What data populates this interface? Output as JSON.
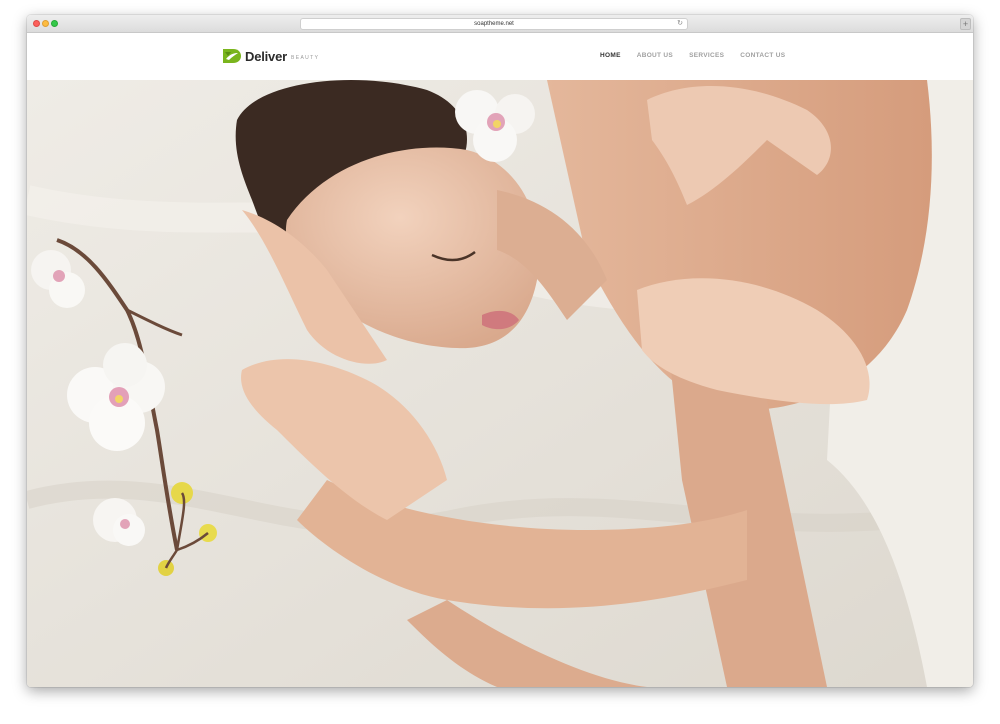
{
  "browser": {
    "url": "soaptheme.net"
  },
  "brand": {
    "name": "Deliver",
    "tagline": "BEAUTY",
    "accent_color": "#7ab51d"
  },
  "nav": {
    "items": [
      {
        "label": "HOME",
        "active": true
      },
      {
        "label": "ABOUT US",
        "active": false
      },
      {
        "label": "SERVICES",
        "active": false
      },
      {
        "label": "CONTACT US",
        "active": false
      }
    ]
  },
  "hero": {
    "icon": "spa-massage-photo"
  }
}
